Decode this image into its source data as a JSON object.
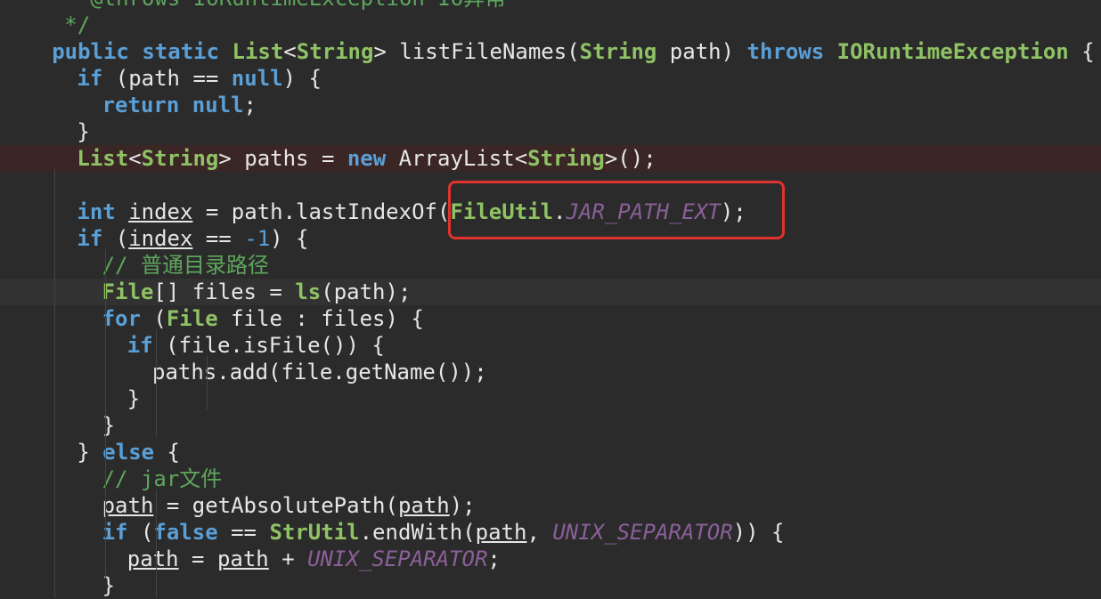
{
  "code_lines": [
    {
      "indent": 3,
      "tokens": [
        [
          "cm",
          "* @throws IORuntimeException IO异常"
        ]
      ]
    },
    {
      "indent": 3,
      "tokens": [
        [
          "cm",
          "*/"
        ]
      ]
    },
    {
      "indent": 2,
      "tokens": [
        [
          "kw",
          "public "
        ],
        [
          "kw",
          "static "
        ],
        [
          "ty",
          "List"
        ],
        [
          "pl",
          "<"
        ],
        [
          "ty",
          "String"
        ],
        [
          "pl",
          "> listFileNames("
        ],
        [
          "ty",
          "String"
        ],
        [
          "pl",
          " path) "
        ],
        [
          "kw",
          "throws "
        ],
        [
          "ty",
          "IORuntimeException"
        ],
        [
          "pl",
          " {"
        ]
      ]
    },
    {
      "indent": 4,
      "tokens": [
        [
          "kw",
          "if"
        ],
        [
          "pl",
          " (path == "
        ],
        [
          "kw",
          "null"
        ],
        [
          "pl",
          ") {"
        ]
      ]
    },
    {
      "indent": 6,
      "tokens": [
        [
          "kw",
          "return "
        ],
        [
          "kw",
          "null"
        ],
        [
          "pl",
          ";"
        ]
      ]
    },
    {
      "indent": 4,
      "tokens": [
        [
          "pl",
          "}"
        ]
      ]
    },
    {
      "indent": 4,
      "tokens": [
        [
          "ty",
          "List"
        ],
        [
          "pl",
          "<"
        ],
        [
          "ty",
          "String"
        ],
        [
          "pl",
          "> paths = "
        ],
        [
          "kw",
          "new"
        ],
        [
          "pl",
          " ArrayList<"
        ],
        [
          "ty",
          "String"
        ],
        [
          "pl",
          ">();"
        ]
      ],
      "bg": "error"
    },
    {
      "indent": 4,
      "tokens": []
    },
    {
      "indent": 4,
      "tokens": [
        [
          "kw",
          "int "
        ],
        [
          "u",
          "index"
        ],
        [
          "pl",
          " = path.lastIndexOf("
        ],
        [
          "ty",
          "FileUtil"
        ],
        [
          "pl",
          "."
        ],
        [
          "const",
          "JAR_PATH_EXT"
        ],
        [
          "pl",
          ");"
        ]
      ]
    },
    {
      "indent": 4,
      "tokens": [
        [
          "kw",
          "if"
        ],
        [
          "pl",
          " ("
        ],
        [
          "u",
          "index"
        ],
        [
          "pl",
          " == "
        ],
        [
          "num",
          "-1"
        ],
        [
          "pl",
          ") {"
        ]
      ]
    },
    {
      "indent": 6,
      "tokens": [
        [
          "cm",
          "// 普通目录路径"
        ]
      ]
    },
    {
      "indent": 6,
      "tokens": [
        [
          "ty",
          "File"
        ],
        [
          "pl",
          "[] files = "
        ],
        [
          "ty",
          "ls"
        ],
        [
          "pl",
          "(path);"
        ]
      ],
      "bg": "current"
    },
    {
      "indent": 6,
      "tokens": [
        [
          "kw",
          "for"
        ],
        [
          "pl",
          " ("
        ],
        [
          "ty",
          "File"
        ],
        [
          "pl",
          " file : files) {"
        ]
      ]
    },
    {
      "indent": 8,
      "tokens": [
        [
          "kw",
          "if"
        ],
        [
          "pl",
          " (file.isFile()) {"
        ]
      ]
    },
    {
      "indent": 10,
      "tokens": [
        [
          "pl",
          "paths.add(file.getName());"
        ]
      ]
    },
    {
      "indent": 8,
      "tokens": [
        [
          "pl",
          "}"
        ]
      ]
    },
    {
      "indent": 6,
      "tokens": [
        [
          "pl",
          "}"
        ]
      ]
    },
    {
      "indent": 4,
      "tokens": [
        [
          "pl",
          "} "
        ],
        [
          "kw",
          "else"
        ],
        [
          "pl",
          " {"
        ]
      ]
    },
    {
      "indent": 6,
      "tokens": [
        [
          "cm",
          "// jar文件"
        ]
      ]
    },
    {
      "indent": 6,
      "tokens": [
        [
          "u",
          "path"
        ],
        [
          "pl",
          " = getAbsolutePath("
        ],
        [
          "u",
          "path"
        ],
        [
          "pl",
          ");"
        ]
      ]
    },
    {
      "indent": 6,
      "tokens": [
        [
          "kw",
          "if"
        ],
        [
          "pl",
          " ("
        ],
        [
          "kw",
          "false"
        ],
        [
          "pl",
          " == "
        ],
        [
          "ty",
          "StrUtil"
        ],
        [
          "pl",
          ".endWith("
        ],
        [
          "u",
          "path"
        ],
        [
          "pl",
          ", "
        ],
        [
          "const",
          "UNIX_SEPARATOR"
        ],
        [
          "pl",
          ")) {"
        ]
      ]
    },
    {
      "indent": 8,
      "tokens": [
        [
          "u",
          "path"
        ],
        [
          "pl",
          " = "
        ],
        [
          "u",
          "path"
        ],
        [
          "pl",
          " + "
        ],
        [
          "const",
          "UNIX_SEPARATOR"
        ],
        [
          "pl",
          ";"
        ]
      ]
    },
    {
      "indent": 6,
      "tokens": [
        [
          "pl",
          "}"
        ]
      ]
    }
  ],
  "annotation": {
    "label": "highlighted-expression",
    "color": "#e0322e"
  }
}
